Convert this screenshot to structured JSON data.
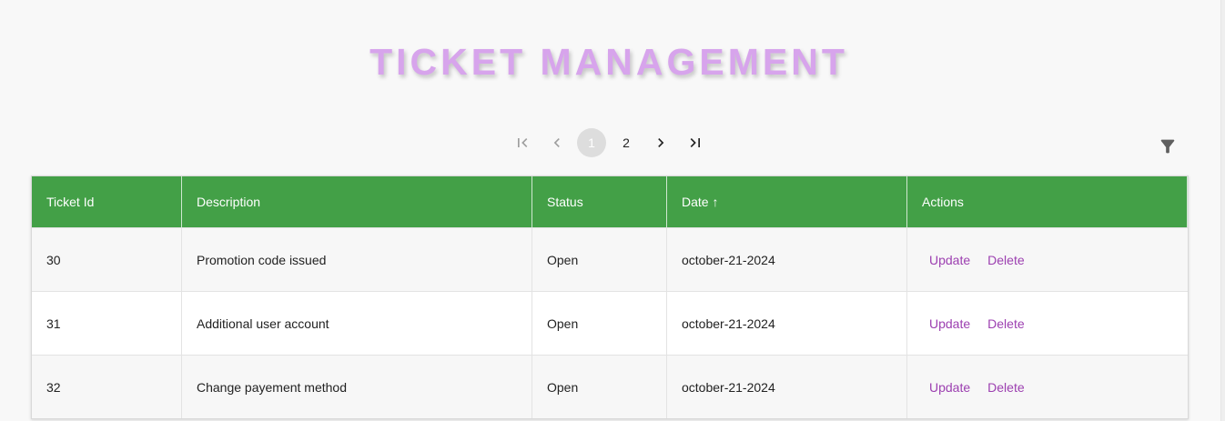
{
  "title": "TICKET MANAGEMENT",
  "pagination": {
    "first_icon": "first-page-icon",
    "prev_icon": "chevron-left-icon",
    "pages": [
      "1",
      "2"
    ],
    "current_page": "1",
    "next_icon": "chevron-right-icon",
    "last_icon": "last-page-icon"
  },
  "filter": {
    "icon": "filter-icon"
  },
  "colors": {
    "header_bg": "#43a047",
    "title": "#d7a4ec",
    "action_link": "#9c3fb0"
  },
  "table": {
    "columns": [
      "Ticket Id",
      "Description",
      "Status",
      "Date ↑",
      "Actions"
    ],
    "rows": [
      {
        "id": "30",
        "description": "Promotion code issued",
        "status": "Open",
        "date": "october-21-2024",
        "update": "Update",
        "delete": "Delete"
      },
      {
        "id": "31",
        "description": "Additional user account",
        "status": "Open",
        "date": "october-21-2024",
        "update": "Update",
        "delete": "Delete"
      },
      {
        "id": "32",
        "description": "Change payement method",
        "status": "Open",
        "date": "october-21-2024",
        "update": "Update",
        "delete": "Delete"
      }
    ]
  }
}
